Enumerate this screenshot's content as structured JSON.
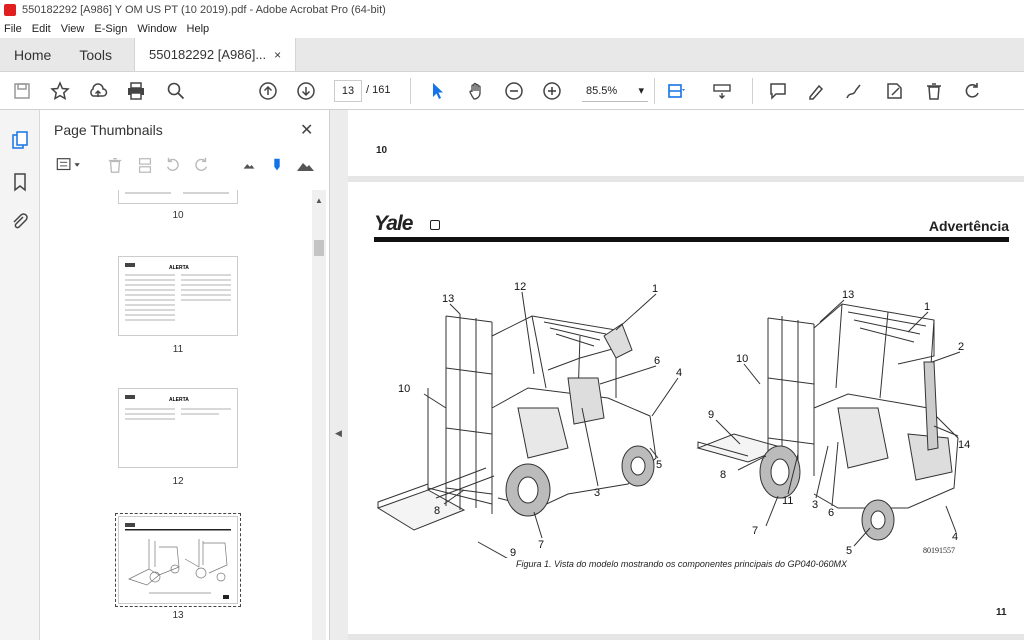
{
  "window": {
    "title": "550182292 [A986] Y OM US PT (10 2019).pdf - Adobe Acrobat Pro (64-bit)"
  },
  "menu": [
    "File",
    "Edit",
    "View",
    "E-Sign",
    "Window",
    "Help"
  ],
  "tabs": {
    "home": "Home",
    "tools": "Tools",
    "doc": "550182292 [A986]...",
    "close": "×"
  },
  "toolbar": {
    "page_current": "13",
    "page_total": "/ 161",
    "zoom": "85.5%",
    "zoom_arrow": "▾"
  },
  "thumbnails": {
    "title": "Page Thumbnails",
    "close": "✕",
    "items": [
      {
        "label": "10"
      },
      {
        "label": "11"
      },
      {
        "label": "12"
      },
      {
        "label": "13"
      }
    ]
  },
  "document": {
    "prev_page_number": "10",
    "brand": "Yale",
    "section_title": "Advertência",
    "callouts_left": [
      "13",
      "12",
      "1",
      "6",
      "4",
      "10",
      "5",
      "3",
      "8",
      "7",
      "9"
    ],
    "callouts_right": [
      "13",
      "1",
      "2",
      "10",
      "9",
      "14",
      "8",
      "11",
      "3",
      "6",
      "7",
      "5",
      "4"
    ],
    "figure_code": "80191557",
    "caption": "Figura  1.  Vista do modelo  mostrando  os  componentes  principais  do  GP040-060MX",
    "page_number": "11"
  }
}
